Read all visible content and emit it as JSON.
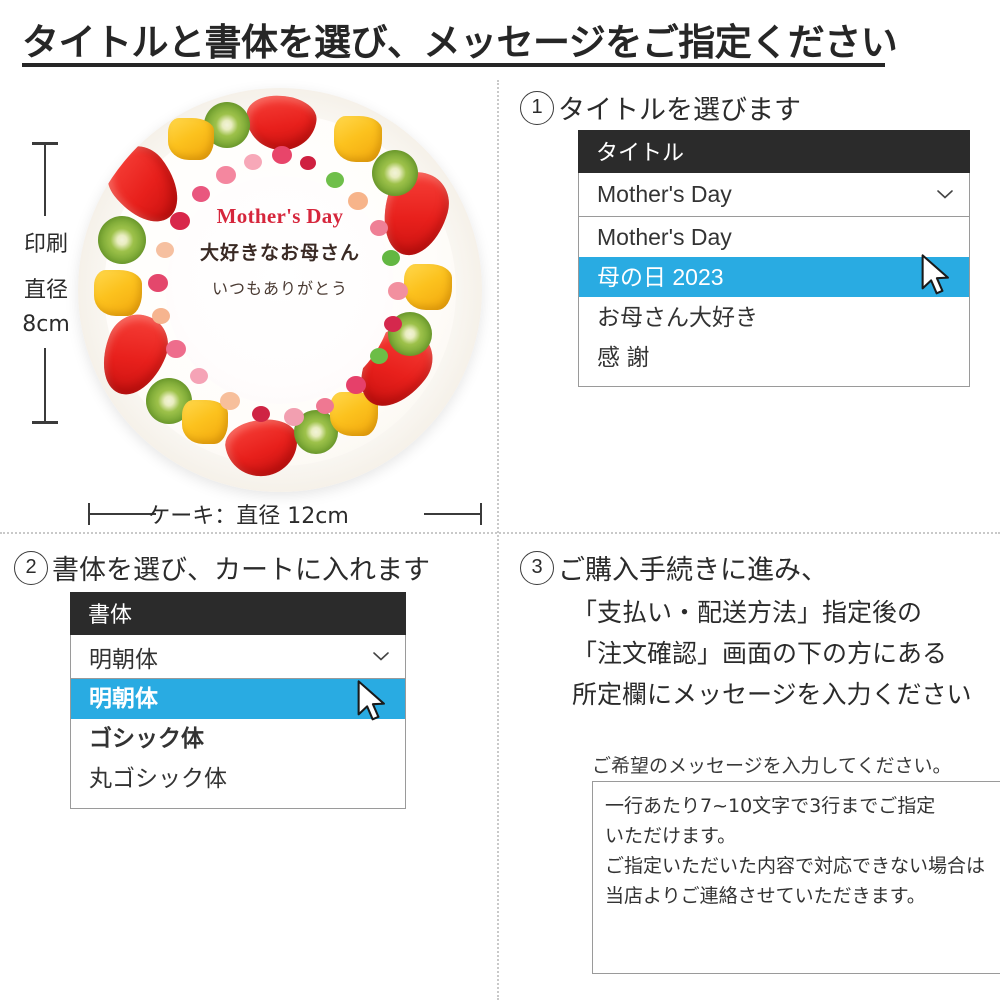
{
  "header": {
    "title": "タイトルと書体を選び、メッセージをご指定ください"
  },
  "cake": {
    "print_dim_line1": "印刷",
    "print_dim_line2": "直径",
    "print_dim_line3": "8cm",
    "caption": "ケーキ：直径 12cm",
    "plate_text_en": "Mother's Day",
    "plate_text_jp1": "大好きなお母さん",
    "plate_text_jp2": "いつもありがとう"
  },
  "step1": {
    "number": "1",
    "heading": "タイトルを選びます",
    "select_header": "タイトル",
    "selected_value": "Mother's Day",
    "chevron_icon": "chevron-down-icon",
    "options": [
      {
        "label": "Mother's Day",
        "selected": false
      },
      {
        "label": "母の日 2023",
        "selected": true
      },
      {
        "label": "お母さん大好き",
        "selected": false
      },
      {
        "label": "感 謝",
        "selected": false
      }
    ]
  },
  "step2": {
    "number": "2",
    "heading": "書体を選び、カートに入れます",
    "select_header": "書体",
    "selected_value": "明朝体",
    "chevron_icon": "chevron-down-icon",
    "options": [
      {
        "label": "明朝体",
        "selected": true,
        "style": "serif"
      },
      {
        "label": "ゴシック体",
        "selected": false,
        "style": "gothic"
      },
      {
        "label": "丸ゴシック体",
        "selected": false,
        "style": "round"
      }
    ]
  },
  "step3": {
    "number": "3",
    "line1": "ご購入手続きに進み、",
    "line2": "「支払い・配送方法」指定後の",
    "line3": "「注文確認」画面の下の方にある",
    "line4": "所定欄にメッセージを入力ください",
    "message_label": "ご希望のメッセージを入力してください。",
    "message_value": "一行あたり7~10文字で3行までご指定\nいただけます。\nご指定いただいた内容で対応できない場合は\n当店よりご連絡させていただきます。"
  },
  "colors": {
    "highlight": "#29ABE2",
    "header_bar": "#2b2b2b",
    "text": "#2b2b2b",
    "divider": "#c9c9c9",
    "cake_title_red": "#d6263c"
  }
}
